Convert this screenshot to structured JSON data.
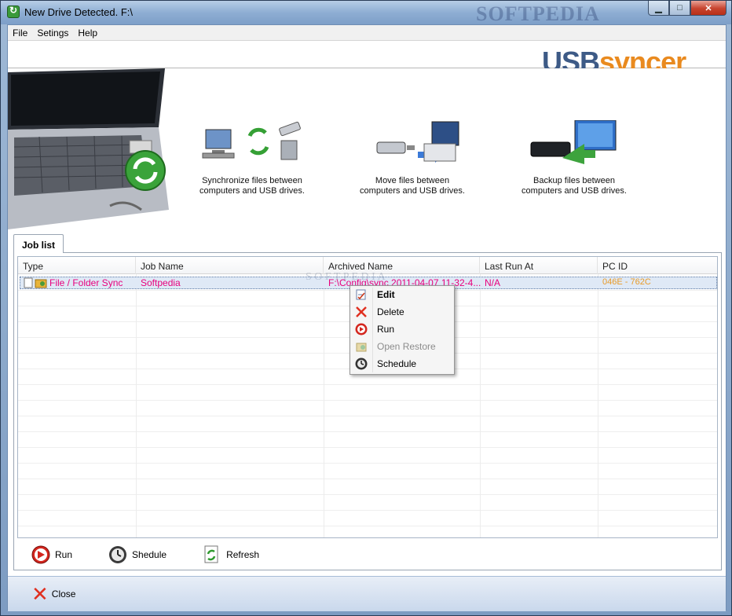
{
  "window": {
    "title": "New Drive Detected. F:\\",
    "watermark": "SOFTPEDIA",
    "controls": {
      "minimize": "▁",
      "maximize": "□",
      "close": "✕"
    }
  },
  "menu": [
    "File",
    "Setings",
    "Help"
  ],
  "logo": {
    "part1": "USB",
    "part2": "syncer"
  },
  "features": [
    {
      "line1": "Synchronize files between",
      "line2": "computers and USB drives."
    },
    {
      "line1": "Move files between",
      "line2": "computers and USB drives."
    },
    {
      "line1": "Backup files between",
      "line2": "computers and USB drives."
    }
  ],
  "tab": {
    "label": "Job list"
  },
  "grid": {
    "headers": [
      "Type",
      "Job Name",
      "Archived Name",
      "Last Run At",
      "PC ID"
    ],
    "rows": [
      {
        "type": "File / Folder Sync",
        "job_name": "Softpedia",
        "archived_name": "F:\\Config\\sync 2011-04-07 11-32-4...",
        "last_run": "N/A",
        "pc_id": "046E - 762C"
      }
    ]
  },
  "toolbar": {
    "run": "Run",
    "schedule": "Shedule",
    "refresh": "Refresh"
  },
  "footer": {
    "close": "Close"
  },
  "context_menu": {
    "items": [
      {
        "label": "Edit",
        "icon": "edit-icon",
        "state": "default"
      },
      {
        "label": "Delete",
        "icon": "delete-icon",
        "state": "enabled"
      },
      {
        "label": "Run",
        "icon": "run-icon",
        "state": "enabled"
      },
      {
        "label": "Open Restore",
        "icon": "restore-icon",
        "state": "disabled"
      },
      {
        "label": "Schedule",
        "icon": "clock-icon",
        "state": "enabled"
      }
    ]
  },
  "colors": {
    "accent_pink": "#e8007d",
    "pc_orange": "#e89b29",
    "logo_blue": "#3d5a86",
    "logo_orange": "#e98a1f"
  }
}
